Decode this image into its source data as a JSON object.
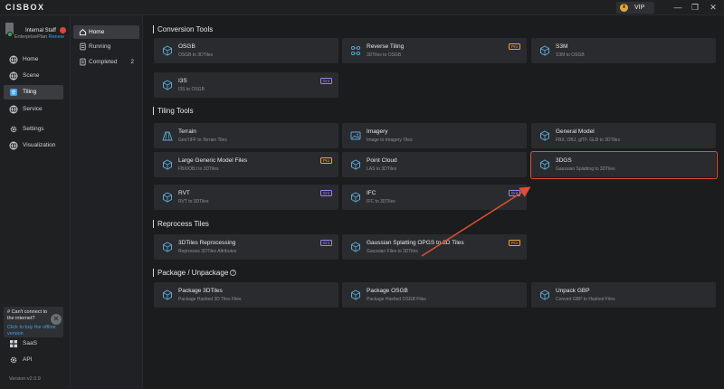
{
  "app": {
    "logo": "CISBOX",
    "vip_label": "VIP",
    "coin_symbol": "¥"
  },
  "window_controls": {
    "minimize": "—",
    "maximize": "❐",
    "close": "✕"
  },
  "user": {
    "name": "Internal Staff",
    "plan": "EnterprisePlan",
    "renew": "Renew"
  },
  "sidebar": {
    "items": [
      {
        "label": "Home",
        "icon": "globe-icon"
      },
      {
        "label": "Scene",
        "icon": "globe-icon"
      },
      {
        "label": "Tiling",
        "icon": "layers-icon",
        "active": true
      },
      {
        "label": "Service",
        "icon": "globe-icon"
      },
      {
        "label": "Settings",
        "icon": "gear-icon"
      },
      {
        "label": "Visualization",
        "icon": "globe-icon"
      }
    ],
    "promo": {
      "text": "# Can't connect to the internet?",
      "link": "Click to buy the offline version",
      "close": "✕"
    },
    "bottom_items": [
      {
        "label": "SaaS",
        "icon": "grid-icon"
      },
      {
        "label": "API",
        "icon": "gear-icon"
      }
    ],
    "version": "Version:v2.0.9"
  },
  "subnav": {
    "items": [
      {
        "label": "Home",
        "active": true
      },
      {
        "label": "Running"
      },
      {
        "label": "Completed",
        "count": "2"
      }
    ]
  },
  "main": {
    "sections": [
      {
        "title": "Conversion Tools"
      },
      {
        "title": "Tiling Tools"
      },
      {
        "title": "Reprocess Tiles"
      },
      {
        "title": "Package / Unpackage"
      }
    ],
    "cards": [
      {
        "title": "OSGB",
        "desc": "OSGB to 3DTiles"
      },
      {
        "title": "Reverse Tiling",
        "desc": "3DTiles to OSGB",
        "tag": "Pro"
      },
      {
        "title": "S3M",
        "desc": "S3M to OSGB"
      },
      {
        "title": "I3S",
        "desc": "I3S to OSGB",
        "tag": "Ent"
      },
      {
        "title": "Terrain",
        "desc": "GeoTIFF to Terrain Tiles"
      },
      {
        "title": "Imagery",
        "desc": "Image to Imagery Tiles"
      },
      {
        "title": "General Model",
        "desc": "FBX, OBJ, glTF, GLB to 3DTiles"
      },
      {
        "title": "Large Generic Model Files",
        "desc": "FBX/OBJ to 3DTiles",
        "tag": "Pro"
      },
      {
        "title": "Point Cloud",
        "desc": "LAS to 3DTiles"
      },
      {
        "title": "3DGS",
        "desc": "Gaussian Splatting to 3DTiles"
      },
      {
        "title": "RVT",
        "desc": "RVT to 3DTiles",
        "tag": "Ent"
      },
      {
        "title": "IFC",
        "desc": "IFC to 3DTiles",
        "tag": "Ent"
      },
      {
        "title": "3DTiles Reprocessing",
        "desc": "Reprocess 3DTiles Attributes",
        "tag": "Ent"
      },
      {
        "title": "Gaussian Splatting OPGS to 3D Tiles",
        "desc": "Gaussian Files to 3DTiles",
        "tag": "Pro"
      },
      {
        "title": "Package 3DTiles",
        "desc": "Package Hashed 3D Tiles Files"
      },
      {
        "title": "Package OSGB",
        "desc": "Package Hashed OSGB Files"
      },
      {
        "title": "Unpack GBP",
        "desc": "Convert GBP to Hashed Files"
      }
    ]
  },
  "colors": {
    "highlight": "#e0502e",
    "pro": "#e3a93a",
    "ent": "#9b84ea",
    "accent": "#3ba3e8",
    "card_icon": "#5aa9d6"
  }
}
